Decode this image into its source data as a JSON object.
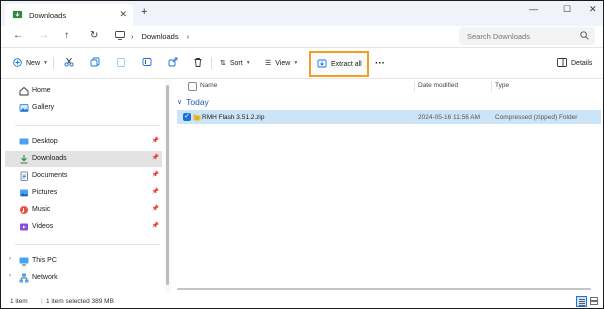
{
  "colors": {
    "accent": "#1a73d9",
    "highlight": "#f0a020",
    "selected_row": "#cce4f7",
    "group_text": "#1f5fa8"
  },
  "tab": {
    "title": "Downloads",
    "icon": "download-folder-icon"
  },
  "window_controls": {
    "minimize": "—",
    "maximize": "☐",
    "close": "✕"
  },
  "address": {
    "crumb": "Downloads",
    "search_placeholder": "Search Downloads"
  },
  "toolbar": {
    "new_label": "New",
    "sort_label": "Sort",
    "view_label": "View",
    "extract_label": "Extract all",
    "more_label": "···",
    "details_label": "Details"
  },
  "sidebar": {
    "quick": [
      {
        "label": "Home",
        "icon": "home-icon"
      },
      {
        "label": "Gallery",
        "icon": "gallery-icon"
      }
    ],
    "pinned": [
      {
        "label": "Desktop",
        "icon": "desktop-icon"
      },
      {
        "label": "Downloads",
        "icon": "download-icon"
      },
      {
        "label": "Documents",
        "icon": "documents-icon"
      },
      {
        "label": "Pictures",
        "icon": "pictures-icon"
      },
      {
        "label": "Music",
        "icon": "music-icon"
      },
      {
        "label": "Videos",
        "icon": "videos-icon"
      }
    ],
    "drives": [
      {
        "label": "This PC",
        "icon": "this-pc-icon"
      },
      {
        "label": "Network",
        "icon": "network-icon"
      }
    ]
  },
  "columns": {
    "name": "Name",
    "date": "Date modified",
    "type": "Type"
  },
  "group": {
    "label": "Today"
  },
  "files": [
    {
      "name": "RMH Flash 3.51.2.zip",
      "date": "2024-05-16 11:56 AM",
      "type": "Compressed (zipped) Folder"
    }
  ],
  "status": {
    "count": "1 item",
    "selection": "1 item selected  389 MB"
  }
}
